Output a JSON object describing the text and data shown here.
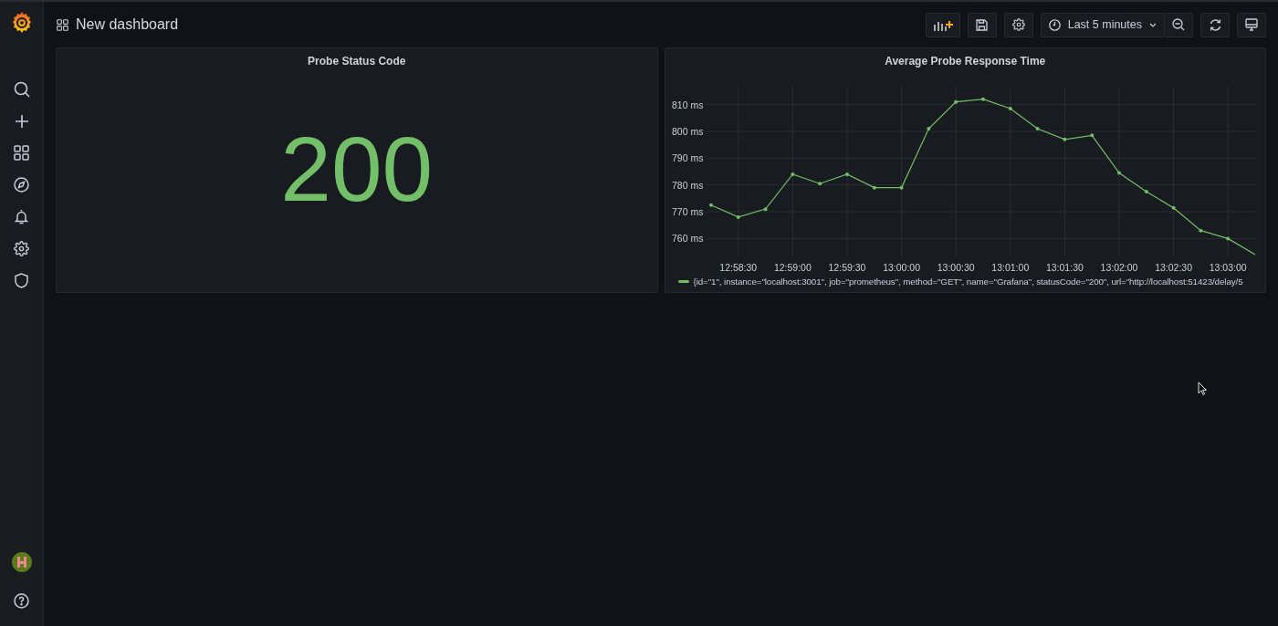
{
  "dashboard": {
    "title": "New dashboard"
  },
  "toolbar": {
    "time_range": "Last 5 minutes"
  },
  "panels": [
    {
      "kind": "stat",
      "title": "Probe Status Code",
      "value": "200"
    },
    {
      "kind": "graph",
      "title": "Average Probe Response Time",
      "chart_data": {
        "type": "line",
        "categories": [
          null,
          "12:58:30",
          null,
          "12:59:00",
          null,
          "12:59:30",
          null,
          "13:00:00",
          null,
          "13:00:30",
          null,
          "13:01:00",
          null,
          "13:01:30",
          null,
          "13:02:00",
          null,
          "13:02:30",
          null,
          "13:03:00",
          null
        ],
        "series": [
          {
            "name": "{id=\"1\", instance=\"localhost:3001\", job=\"prometheus\", method=\"GET\", name=\"Grafana\", statusCode=\"200\", url=\"http://localhost:51423/delay/5",
            "color": "#73bf69",
            "values": [
              772.5,
              768,
              771,
              784,
              780.5,
              784,
              779,
              779,
              801,
              811,
              812,
              808.5,
              801,
              797,
              798.5,
              784.5,
              777.5,
              771.5,
              763,
              760,
              754
            ]
          }
        ],
        "ylim": [
          753,
          817
        ],
        "grid": true,
        "yticks": [
          {
            "value": 760,
            "label": "760 ms"
          },
          {
            "value": 770,
            "label": "770 ms"
          },
          {
            "value": 780,
            "label": "780 ms"
          },
          {
            "value": 790,
            "label": "790 ms"
          },
          {
            "value": 800,
            "label": "800 ms"
          },
          {
            "value": 810,
            "label": "810 ms"
          }
        ]
      }
    }
  ]
}
